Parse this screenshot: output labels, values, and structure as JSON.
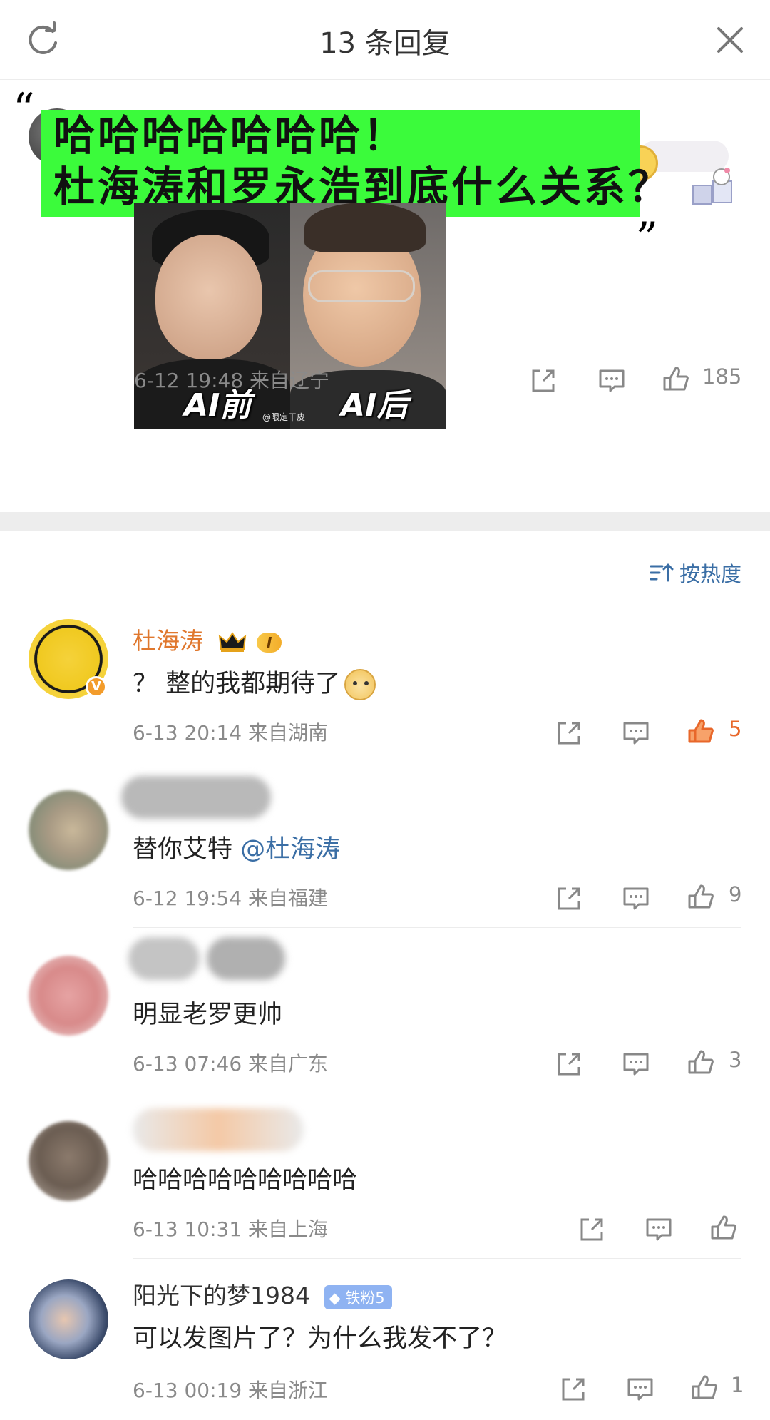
{
  "header": {
    "title": "13 条回复",
    "refresh_icon": "refresh-icon",
    "close_icon": "close-icon"
  },
  "main_post": {
    "banner_line1": "哈哈哈哈哈哈哈！",
    "banner_line2": "杜海涛和罗永浩到底什么关系？",
    "image_label_left": "AI前",
    "image_label_right": "AI后",
    "image_watermark": "@限定干皮",
    "meta": "6-12 19:48  来自辽宁",
    "likes": "185"
  },
  "sort": {
    "label": "按热度"
  },
  "comments": [
    {
      "name": "杜海涛",
      "level": "I",
      "text": "？ 整的我都期待了",
      "meta": "6-13 20:14  来自湖南",
      "likes": "5",
      "liked": true,
      "verified": "V"
    },
    {
      "text_prefix": "替你艾特 ",
      "mention": "@杜海涛",
      "meta": "6-12 19:54  来自福建",
      "likes": "9"
    },
    {
      "text": "明显老罗更帅",
      "meta": "6-13 07:46  来自广东",
      "likes": "3"
    },
    {
      "text": "哈哈哈哈哈哈哈哈哈",
      "meta": "6-13 10:31  来自上海",
      "likes": ""
    },
    {
      "name": "阳光下的梦1984",
      "fan_badge": "铁粉5",
      "text": "可以发图片了？为什么我发不了？",
      "meta": "6-13 00:19  来自浙江",
      "likes": "1"
    }
  ],
  "colors": {
    "banner_green": "#3bfb3b",
    "link_blue": "#3a6ea5",
    "name_orange": "#e0782e",
    "liked_orange": "#f07a32",
    "meta_gray": "#8a8a8a"
  }
}
